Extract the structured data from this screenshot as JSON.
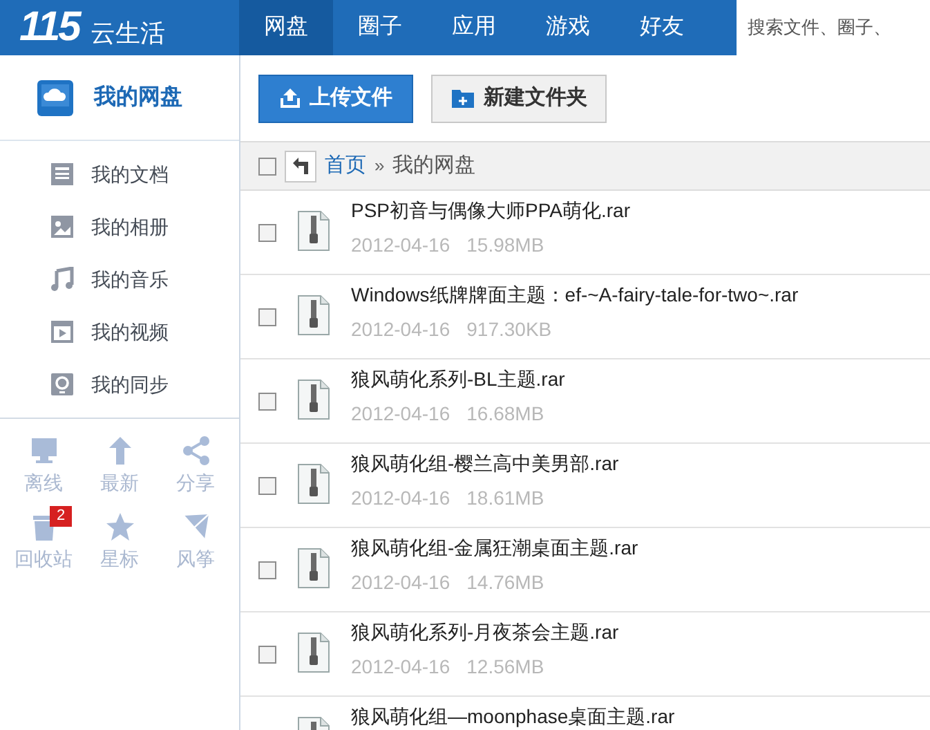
{
  "logo": {
    "mark": "115",
    "text": "云生活"
  },
  "nav": [
    {
      "label": "网盘",
      "selected": true
    },
    {
      "label": "圈子",
      "selected": false
    },
    {
      "label": "应用",
      "selected": false
    },
    {
      "label": "游戏",
      "selected": false
    },
    {
      "label": "好友",
      "selected": false
    }
  ],
  "search": {
    "placeholder": "搜索文件、圈子、"
  },
  "sidebar": {
    "title": "我的网盘",
    "items": [
      {
        "label": "我的文档"
      },
      {
        "label": "我的相册"
      },
      {
        "label": "我的音乐"
      },
      {
        "label": "我的视频"
      },
      {
        "label": "我的同步"
      }
    ],
    "tools": [
      {
        "label": "离线"
      },
      {
        "label": "最新"
      },
      {
        "label": "分享"
      },
      {
        "label": "回收站",
        "badge": "2"
      },
      {
        "label": "星标"
      },
      {
        "label": "风筝"
      }
    ]
  },
  "toolbar": {
    "upload": "上传文件",
    "new_folder": "新建文件夹"
  },
  "breadcrumb": {
    "checked": false,
    "home": "首页",
    "separator": "»",
    "current": "我的网盘"
  },
  "files": [
    {
      "name": "PSP初音与偶像大师PPA萌化.rar",
      "date": "2012-04-16",
      "size": "15.98MB",
      "checked": false
    },
    {
      "name": "Windows纸牌牌面主题：ef-~A-fairy-tale-for-two~.rar",
      "date": "2012-04-16",
      "size": "917.30KB",
      "checked": false
    },
    {
      "name": "狼风萌化系列-BL主题.rar",
      "date": "2012-04-16",
      "size": "16.68MB",
      "checked": false
    },
    {
      "name": "狼风萌化组-樱兰高中美男部.rar",
      "date": "2012-04-16",
      "size": "18.61MB",
      "checked": false
    },
    {
      "name": "狼风萌化组-金属狂潮桌面主题.rar",
      "date": "2012-04-16",
      "size": "14.76MB",
      "checked": false
    },
    {
      "name": "狼风萌化系列-月夜茶会主题.rar",
      "date": "2012-04-16",
      "size": "12.56MB",
      "checked": false
    },
    {
      "name": "狼风萌化组—moonphase桌面主题.rar"
    }
  ]
}
